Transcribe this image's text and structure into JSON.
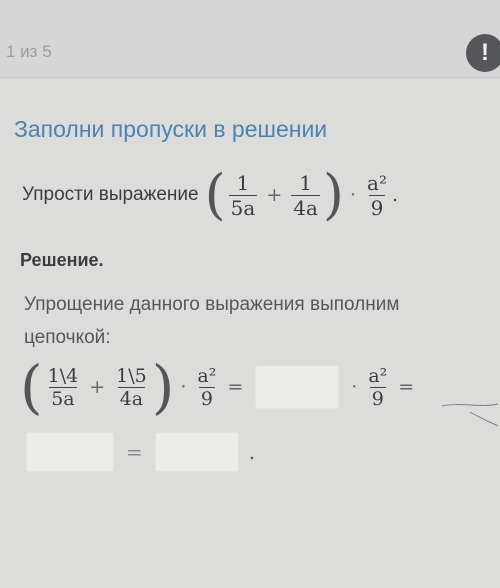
{
  "header": {
    "progress": "1 из 5",
    "alert_icon": "!"
  },
  "task": {
    "title": "Заполни пропуски в решении",
    "prompt_label": "Упрости выражение",
    "expr": {
      "frac1_num": "1",
      "frac1_den": "5a",
      "plus": "+",
      "frac2_num": "1",
      "frac2_den": "4a",
      "dot": "·",
      "frac3_num": "a²",
      "frac3_den": "9",
      "end": "."
    }
  },
  "solution": {
    "heading": "Решение.",
    "text": "Упрощение данного выражения выполним цепочкой:",
    "chain": {
      "frac1_num": "1\\4",
      "frac1_den": "5a",
      "plus": "+",
      "frac2_num": "1\\5",
      "frac2_den": "4a",
      "dot": "·",
      "frac3_num": "a²",
      "frac3_den": "9",
      "eq": "=",
      "blank1": "",
      "frac4_num": "a²",
      "frac4_den": "9",
      "eq2": "=",
      "blank2": "",
      "eq3": "=",
      "blank3": "",
      "end": "."
    }
  }
}
